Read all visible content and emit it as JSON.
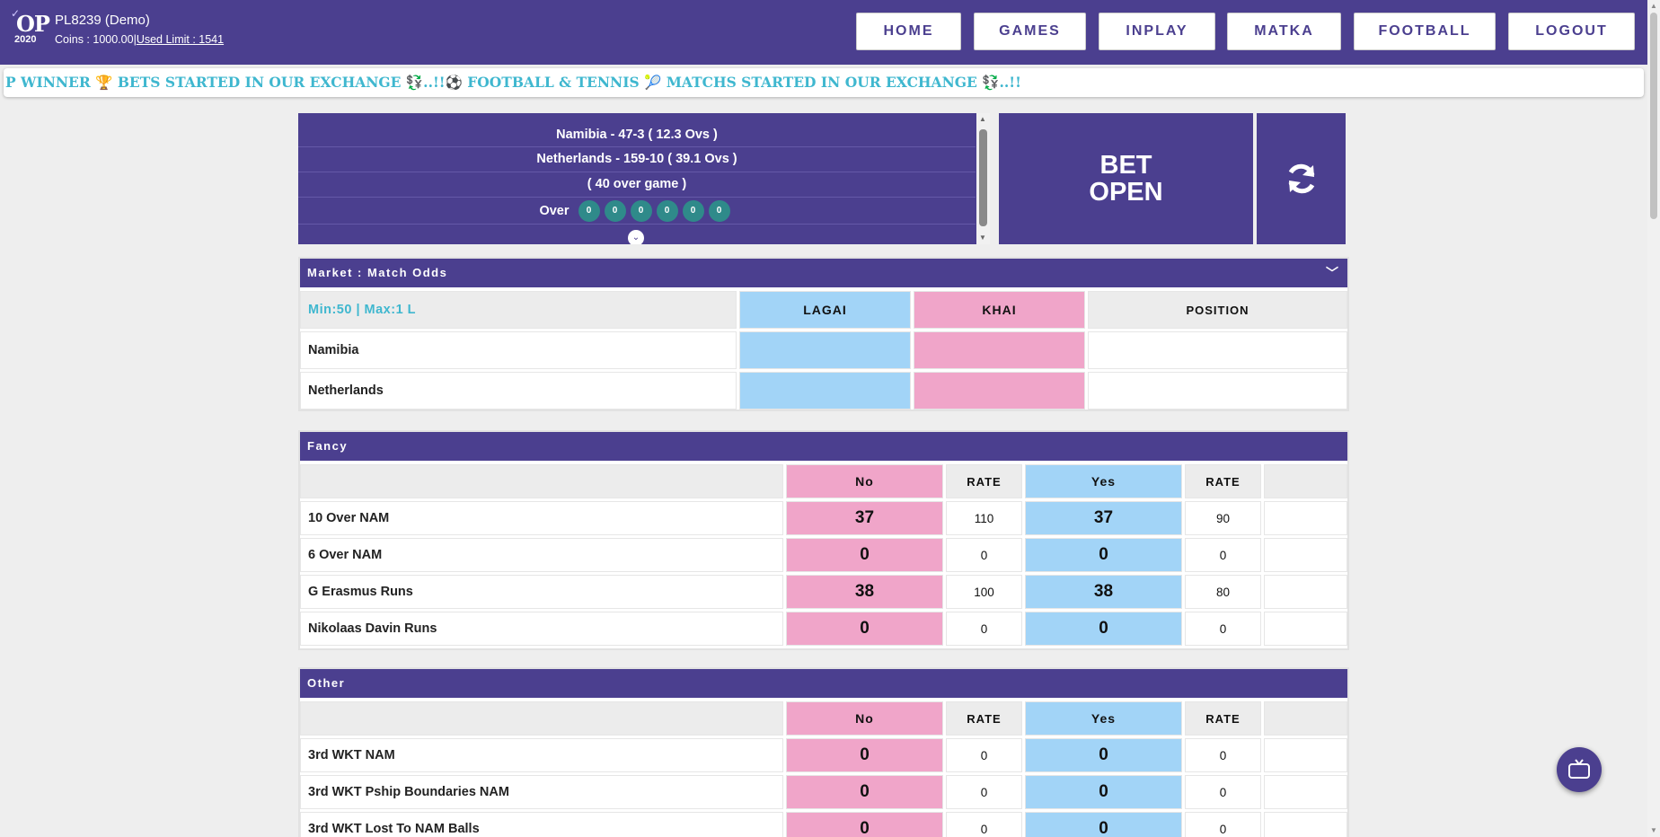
{
  "header": {
    "logo_text": "OP",
    "logo_year": "2020",
    "user_id": "PL8239 (Demo)",
    "coins_label": "Coins : 1000.00",
    "separator": "|",
    "used_limit": "Used Limit : 1541",
    "nav": [
      "HOME",
      "GAMES",
      "INPLAY",
      "MATKA",
      "FOOTBALL",
      "LOGOUT"
    ]
  },
  "ticker": {
    "text": "P WINNER 🏆 BETS STARTED IN OUR EXCHANGE 💱..!!⚽ FOOTBALL & TENNIS 🎾 MATCHS STARTED IN OUR EXCHANGE 💱..!!"
  },
  "score": {
    "line1": "Namibia - 47-3 ( 12.3 Ovs )",
    "line2": "Netherlands - 159-10 ( 39.1 Ovs )",
    "line3": "( 40 over game )",
    "over_label": "Over",
    "balls": [
      "0",
      "0",
      "0",
      "0",
      "0",
      "0"
    ]
  },
  "bet_open": {
    "line1": "BET",
    "line2": "OPEN"
  },
  "match_odds": {
    "title": "Market : Match Odds",
    "limits": "Min:50 | Max:1 L",
    "lagai": "LAGAI",
    "khai": "KHAI",
    "position": "POSITION",
    "teams": [
      "Namibia",
      "Netherlands"
    ]
  },
  "fancy": {
    "title": "Fancy",
    "no": "No",
    "yes": "Yes",
    "rate": "RATE",
    "rows": [
      {
        "name": "10 Over NAM",
        "no": "37",
        "no_rate": "110",
        "yes": "37",
        "yes_rate": "90"
      },
      {
        "name": "6 Over NAM",
        "no": "0",
        "no_rate": "0",
        "yes": "0",
        "yes_rate": "0"
      },
      {
        "name": "G Erasmus Runs",
        "no": "38",
        "no_rate": "100",
        "yes": "38",
        "yes_rate": "80"
      },
      {
        "name": "Nikolaas Davin Runs",
        "no": "0",
        "no_rate": "0",
        "yes": "0",
        "yes_rate": "0"
      }
    ]
  },
  "other": {
    "title": "Other",
    "no": "No",
    "yes": "Yes",
    "rate": "RATE",
    "rows": [
      {
        "name": "3rd WKT NAM",
        "no": "0",
        "no_rate": "0",
        "yes": "0",
        "yes_rate": "0"
      },
      {
        "name": "3rd WKT Pship Boundaries NAM",
        "no": "0",
        "no_rate": "0",
        "yes": "0",
        "yes_rate": "0"
      },
      {
        "name": "3rd WKT Lost To NAM Balls",
        "no": "0",
        "no_rate": "0",
        "yes": "0",
        "yes_rate": "0"
      }
    ]
  },
  "colors": {
    "brand": "#4b3f8f",
    "lagai_blue": "#a2d4f7",
    "khai_pink": "#f0a5c9",
    "ticker_text": "#3fb7cf"
  }
}
